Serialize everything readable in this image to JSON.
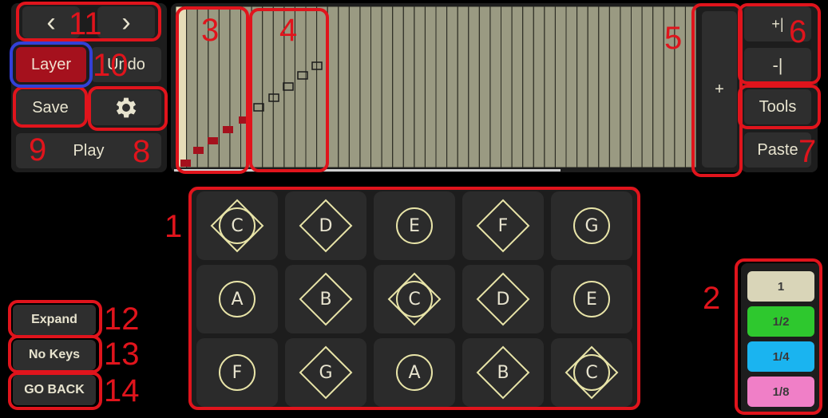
{
  "nav": {
    "prev_glyph": "‹",
    "next_glyph": "›"
  },
  "left_controls": {
    "layer": "Layer",
    "undo": "Undo",
    "save": "Save",
    "settings_icon": "gear-icon",
    "play": "Play"
  },
  "grid": {
    "columns": 48,
    "active_column": 0,
    "cursor_glyph": "+"
  },
  "zoom": {
    "zoom_in": "+|",
    "zoom_out": "-|"
  },
  "right_controls": {
    "tools": "Tools",
    "paste": "Paste"
  },
  "pads": [
    [
      "C",
      "D",
      "E",
      "F",
      "G"
    ],
    [
      "A",
      "B",
      "C",
      "D",
      "E"
    ],
    [
      "F",
      "G",
      "A",
      "B",
      "C"
    ]
  ],
  "pad_shapes": [
    [
      "circle-diamond",
      "diamond",
      "circle",
      "diamond",
      "circle"
    ],
    [
      "circle",
      "diamond",
      "circle-diamond",
      "diamond",
      "circle"
    ],
    [
      "circle",
      "diamond",
      "circle",
      "diamond",
      "circle-diamond"
    ]
  ],
  "durations": [
    {
      "label": "1",
      "color": "#d9d5b8"
    },
    {
      "label": "1/2",
      "color": "#2ec82e"
    },
    {
      "label": "1/4",
      "color": "#1ab4f0"
    },
    {
      "label": "1/8",
      "color": "#f07fc7"
    }
  ],
  "bottom_left": {
    "expand": "Expand",
    "no_keys": "No Keys",
    "go_back": "GO BACK"
  },
  "annotations": [
    "1",
    "2",
    "3",
    "4",
    "5",
    "6",
    "7",
    "8",
    "9",
    "10",
    "11",
    "12",
    "13",
    "14"
  ],
  "colors": {
    "accent": "#e0141c",
    "layer_active": "#a5111d",
    "grid_bg": "#9a9a82",
    "pad_line": "#e8e4a8"
  }
}
